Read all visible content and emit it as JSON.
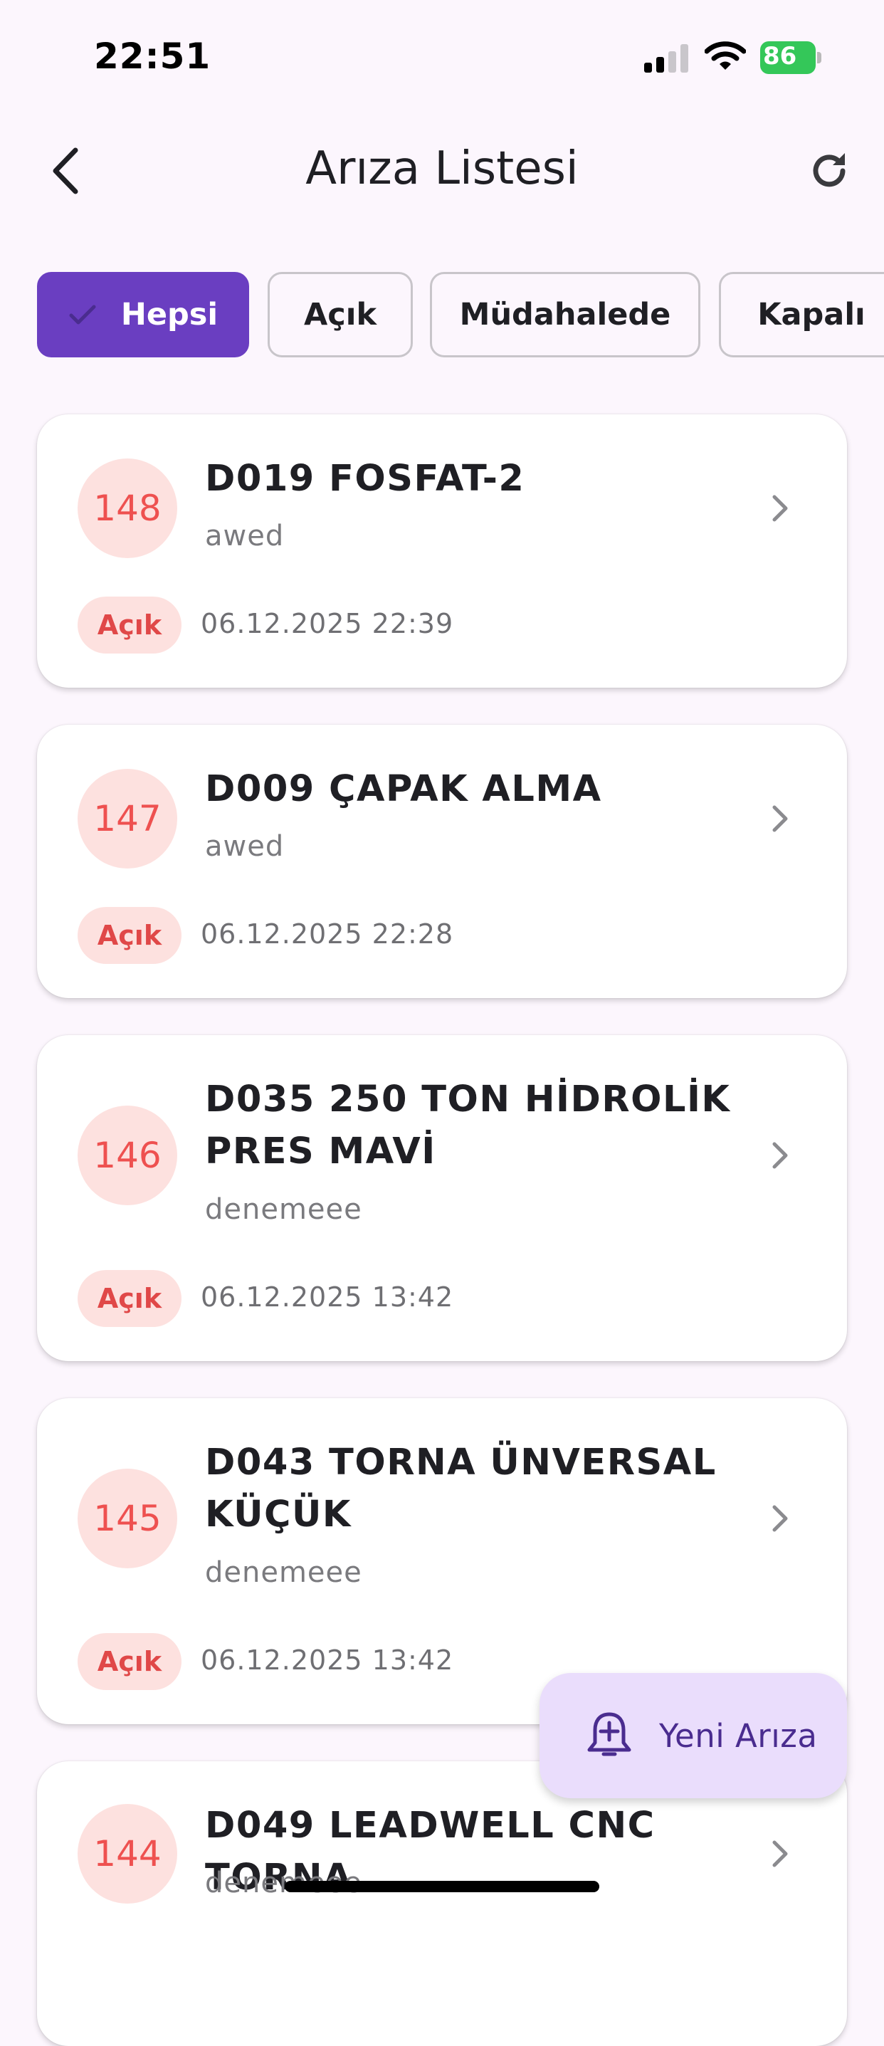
{
  "status_bar": {
    "time": "22:51",
    "battery": "86"
  },
  "header": {
    "title": "Arıza Listesi"
  },
  "filters": [
    {
      "label": "Hepsi",
      "selected": true
    },
    {
      "label": "Açık",
      "selected": false
    },
    {
      "label": "Müdahalede",
      "selected": false
    },
    {
      "label": "Kapalı",
      "selected": false
    }
  ],
  "faults": [
    {
      "id": "148",
      "title": "D019 FOSFAT-2",
      "description": "awed",
      "status": "Açık",
      "date": "06.12.2025 22:39"
    },
    {
      "id": "147",
      "title": "D009 ÇAPAK ALMA",
      "description": "awed",
      "status": "Açık",
      "date": "06.12.2025 22:28"
    },
    {
      "id": "146",
      "title": "D035 250 TON HİDROLİK PRES MAVİ",
      "description": "denemeee",
      "status": "Açık",
      "date": "06.12.2025 13:42"
    },
    {
      "id": "145",
      "title": "D043 TORNA ÜNVERSAL KÜÇÜK",
      "description": "denemeee",
      "status": "Açık",
      "date": "06.12.2025 13:42"
    },
    {
      "id": "144",
      "title": "D049 LEADWELL CNC TORNA",
      "description": "denemeee",
      "status": "",
      "date": ""
    }
  ],
  "fab": {
    "label": "Yeni Arıza"
  },
  "colors": {
    "primary": "#6A3EC1",
    "background": "#FCF6FD",
    "status_open_bg": "#FDE1DF",
    "status_open_text": "#EE5150",
    "fab_bg": "#EADDFC"
  },
  "icons": {
    "back": "chevron-left-icon",
    "refresh": "refresh-icon",
    "check": "check-icon",
    "chevron": "chevron-right-icon",
    "fab": "alarm-bell-add-icon"
  }
}
